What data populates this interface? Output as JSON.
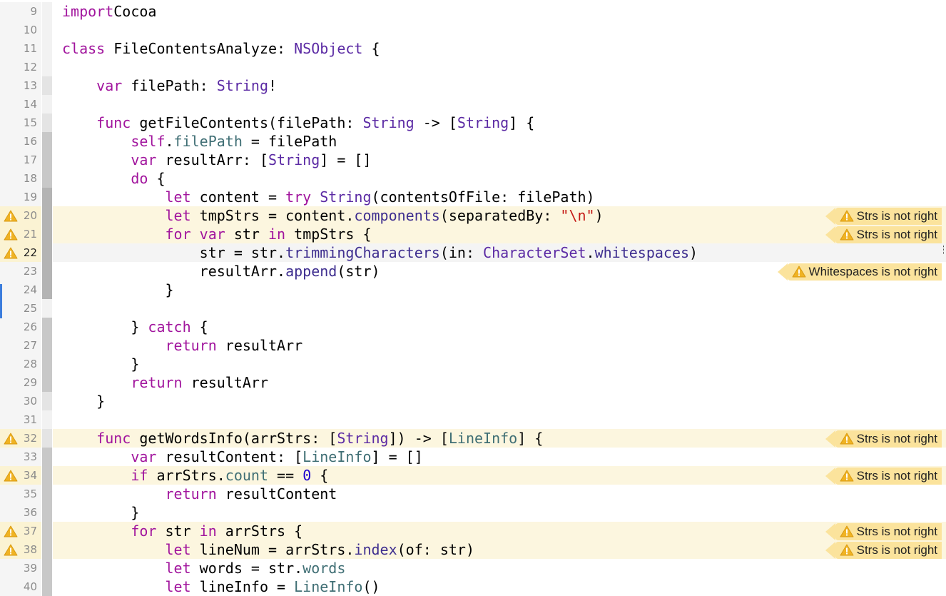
{
  "editor": {
    "language": "Swift",
    "current_line": 22,
    "lines": [
      {
        "n": "9",
        "tokens": [
          [
            "kw",
            "import"
          ],
          [
            "",
            "Cocoa"
          ]
        ]
      },
      {
        "n": "10",
        "tokens": []
      },
      {
        "n": "11",
        "tokens": [
          [
            "kw",
            "class"
          ],
          [
            "",
            " FileContentsAnalyze: "
          ],
          [
            "ty",
            "NSObject"
          ],
          [
            "",
            " {"
          ]
        ]
      },
      {
        "n": "12",
        "tokens": []
      },
      {
        "n": "13",
        "tokens": [
          [
            "",
            "    "
          ],
          [
            "kw",
            "var"
          ],
          [
            "",
            " filePath: "
          ],
          [
            "ty",
            "String"
          ],
          [
            "",
            "!"
          ]
        ]
      },
      {
        "n": "14",
        "tokens": []
      },
      {
        "n": "15",
        "tokens": [
          [
            "",
            "    "
          ],
          [
            "kw",
            "func"
          ],
          [
            "",
            " getFileContents(filePath: "
          ],
          [
            "ty",
            "String"
          ],
          [
            "",
            " -> ["
          ],
          [
            "ty",
            "String"
          ],
          [
            "",
            "] {"
          ]
        ]
      },
      {
        "n": "16",
        "tokens": [
          [
            "",
            "        "
          ],
          [
            "kw",
            "self"
          ],
          [
            "",
            "."
          ],
          [
            "pr",
            "filePath"
          ],
          [
            "",
            " = filePath"
          ]
        ]
      },
      {
        "n": "17",
        "tokens": [
          [
            "",
            "        "
          ],
          [
            "kw",
            "var"
          ],
          [
            "",
            " resultArr: ["
          ],
          [
            "ty",
            "String"
          ],
          [
            "",
            "] = []"
          ]
        ]
      },
      {
        "n": "18",
        "tokens": [
          [
            "",
            "        "
          ],
          [
            "kw",
            "do"
          ],
          [
            "",
            " {"
          ]
        ]
      },
      {
        "n": "19",
        "tokens": [
          [
            "",
            "            "
          ],
          [
            "kw",
            "let"
          ],
          [
            "",
            " content = "
          ],
          [
            "kw",
            "try"
          ],
          [
            "",
            " "
          ],
          [
            "ty",
            "String"
          ],
          [
            "",
            "(contentsOfFile: filePath)"
          ]
        ]
      },
      {
        "n": "20",
        "warn": true,
        "badge": "Strs is not right",
        "tokens": [
          [
            "",
            "            "
          ],
          [
            "kw",
            "let"
          ],
          [
            "",
            " tmpStrs = content."
          ],
          [
            "me",
            "components"
          ],
          [
            "",
            "(separatedBy: "
          ],
          [
            "st",
            "\"\\n\""
          ],
          [
            "",
            ")"
          ]
        ]
      },
      {
        "n": "21",
        "warn": true,
        "badge": "Strs is not right",
        "tokens": [
          [
            "",
            "            "
          ],
          [
            "kw",
            "for"
          ],
          [
            "",
            " "
          ],
          [
            "kw",
            "var"
          ],
          [
            "",
            " str "
          ],
          [
            "kw",
            "in"
          ],
          [
            "",
            " tmpStrs {"
          ]
        ]
      },
      {
        "n": "22",
        "warn": true,
        "current": true,
        "tokens": [
          [
            "",
            "                str = str."
          ],
          [
            "me",
            "trimmingCharacters"
          ],
          [
            "",
            "(in: "
          ],
          [
            "ty",
            "CharacterSet"
          ],
          [
            "",
            "."
          ],
          [
            "me",
            "whitespaces"
          ],
          [
            "",
            ")"
          ]
        ]
      },
      {
        "n": "23",
        "badge": "Whitespaces is not right",
        "tokens": [
          [
            "",
            "                resultArr."
          ],
          [
            "me",
            "append"
          ],
          [
            "",
            "(str)"
          ]
        ]
      },
      {
        "n": "24",
        "tokens": [
          [
            "",
            "            }"
          ]
        ]
      },
      {
        "n": "25",
        "tokens": []
      },
      {
        "n": "26",
        "tokens": [
          [
            "",
            "        } "
          ],
          [
            "kw",
            "catch"
          ],
          [
            "",
            " {"
          ]
        ]
      },
      {
        "n": "27",
        "tokens": [
          [
            "",
            "            "
          ],
          [
            "kw",
            "return"
          ],
          [
            "",
            " resultArr"
          ]
        ]
      },
      {
        "n": "28",
        "tokens": [
          [
            "",
            "        }"
          ]
        ]
      },
      {
        "n": "29",
        "tokens": [
          [
            "",
            "        "
          ],
          [
            "kw",
            "return"
          ],
          [
            "",
            " resultArr"
          ]
        ]
      },
      {
        "n": "30",
        "tokens": [
          [
            "",
            "    }"
          ]
        ]
      },
      {
        "n": "31",
        "tokens": []
      },
      {
        "n": "32",
        "warn": true,
        "badge": "Strs is not right",
        "tokens": [
          [
            "",
            "    "
          ],
          [
            "kw",
            "func"
          ],
          [
            "",
            " getWordsInfo(arrStrs: ["
          ],
          [
            "ty",
            "String"
          ],
          [
            "",
            "]) -> ["
          ],
          [
            "pr",
            "LineInfo"
          ],
          [
            "",
            "] {"
          ]
        ]
      },
      {
        "n": "33",
        "tokens": [
          [
            "",
            "        "
          ],
          [
            "kw",
            "var"
          ],
          [
            "",
            " resultContent: ["
          ],
          [
            "pr",
            "LineInfo"
          ],
          [
            "",
            "] = []"
          ]
        ]
      },
      {
        "n": "34",
        "warn": true,
        "badge": "Strs is not right",
        "tokens": [
          [
            "",
            "        "
          ],
          [
            "kw",
            "if"
          ],
          [
            "",
            " arrStrs."
          ],
          [
            "pr",
            "count"
          ],
          [
            "",
            " == "
          ],
          [
            "nu",
            "0"
          ],
          [
            "",
            " {"
          ]
        ]
      },
      {
        "n": "35",
        "tokens": [
          [
            "",
            "            "
          ],
          [
            "kw",
            "return"
          ],
          [
            "",
            " resultContent"
          ]
        ]
      },
      {
        "n": "36",
        "tokens": [
          [
            "",
            "        }"
          ]
        ]
      },
      {
        "n": "37",
        "warn": true,
        "badge": "Strs is not right",
        "tokens": [
          [
            "",
            "        "
          ],
          [
            "kw",
            "for"
          ],
          [
            "",
            " str "
          ],
          [
            "kw",
            "in"
          ],
          [
            "",
            " arrStrs {"
          ]
        ]
      },
      {
        "n": "38",
        "warn": true,
        "badge": "Strs is not right",
        "tokens": [
          [
            "",
            "            "
          ],
          [
            "kw",
            "let"
          ],
          [
            "",
            " lineNum = arrStrs."
          ],
          [
            "me",
            "index"
          ],
          [
            "",
            "(of: str)"
          ]
        ]
      },
      {
        "n": "39",
        "tokens": [
          [
            "",
            "            "
          ],
          [
            "kw",
            "let"
          ],
          [
            "",
            " words = str."
          ],
          [
            "pr",
            "words"
          ]
        ]
      },
      {
        "n": "40",
        "tokens": [
          [
            "",
            "            "
          ],
          [
            "kw",
            "let"
          ],
          [
            "",
            " lineInfo = "
          ],
          [
            "pr",
            "LineInfo"
          ],
          [
            "",
            "()"
          ]
        ]
      }
    ]
  },
  "icons": {
    "warning": "warning-triangle-icon"
  },
  "colors": {
    "keyword": "#a1149d",
    "type": "#5b2aa4",
    "property": "#3f6e74",
    "method": "#3e2e8f",
    "string": "#c41a16",
    "number": "#1c00cf",
    "warning_badge": "#fbe39c",
    "warning_line": "#fcf6df"
  }
}
